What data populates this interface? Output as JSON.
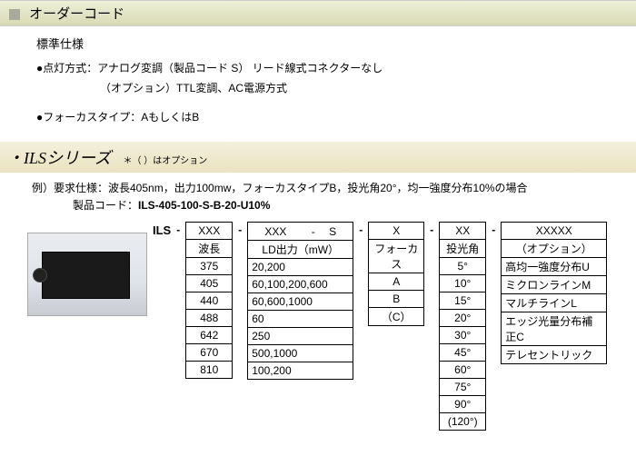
{
  "header": {
    "title": "オーダーコード"
  },
  "spec": {
    "standard": "標準仕様",
    "l1": "●点灯方式：アナログ変調（製品コード S） リード線式コネクターなし",
    "l2": "（オプション）TTL変調、AC電源方式",
    "l3": "●フォーカスタイプ：AもしくはB"
  },
  "series": {
    "title": "・ILSシリーズ",
    "note": "＊（ ）はオプション"
  },
  "example": {
    "l1": "例）要求仕様：波長405nm，出力100mw，フォーカスタイプB，投光角20°，均一強度分布10%の場合",
    "l2a": "製品コード：",
    "l2b": "ILS-405-100-S-B-20-U10%"
  },
  "prefix": "ILS",
  "dash": "-",
  "tables": {
    "wavelength": {
      "h1": "XXX",
      "h2": "波長",
      "rows": [
        "375",
        "405",
        "440",
        "488",
        "642",
        "670",
        "810"
      ]
    },
    "power": {
      "h1": "XXX　　 - 　S",
      "h2": "LD出力（mW）",
      "rows": [
        "20,200",
        "60,100,200,600",
        "60,600,1000",
        "60",
        "250",
        "500,1000",
        "100,200"
      ]
    },
    "focus": {
      "h1": "X",
      "h2": "フォーカス",
      "rows": [
        "A",
        "B",
        "（C）"
      ]
    },
    "angle": {
      "h1": "XX",
      "h2": "投光角",
      "rows": [
        "5°",
        "10°",
        "15°",
        "20°",
        "30°",
        "45°",
        "60°",
        "75°",
        "90°",
        "(120°)"
      ]
    },
    "option": {
      "h1": "XXXXX",
      "h2": "（オプション）",
      "rows": [
        "高均一強度分布U",
        "ミクロンラインM",
        "マルチラインL",
        "エッジ光量分布補正C",
        "テレセントリック"
      ]
    }
  }
}
